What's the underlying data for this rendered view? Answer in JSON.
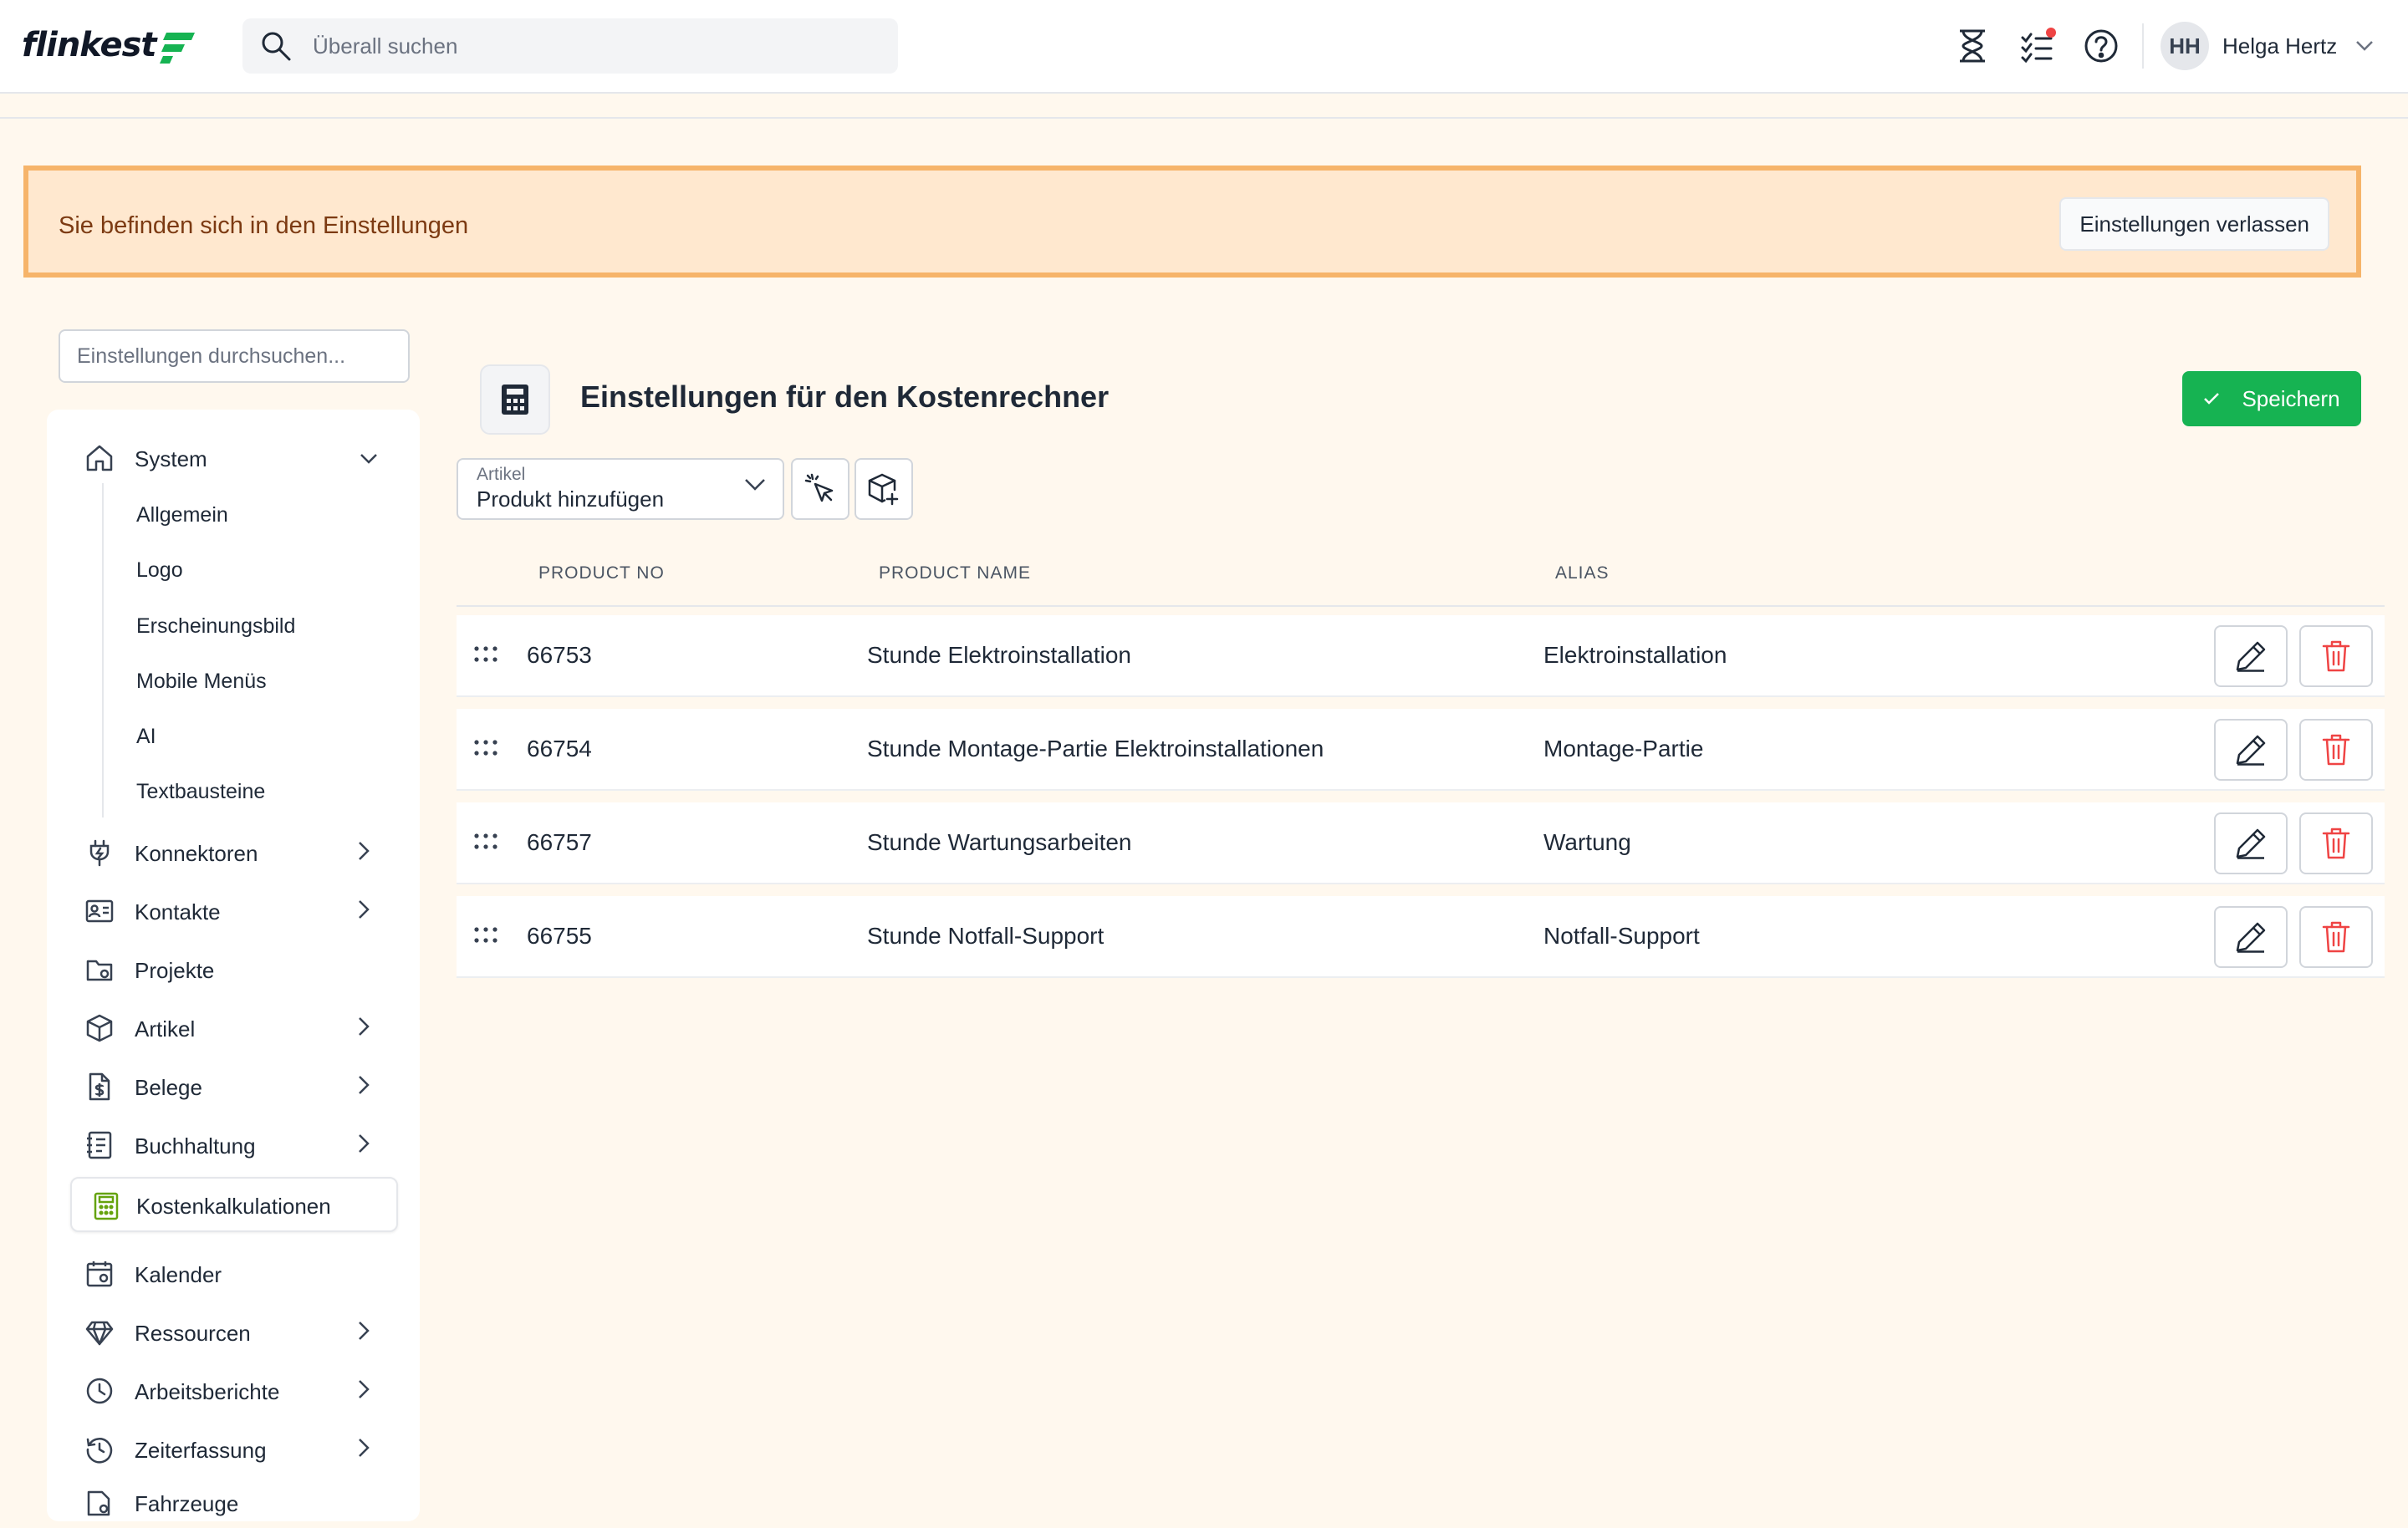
{
  "app": {
    "logo_text": "flinkest",
    "brand_color": "#16b352",
    "accent_warning": "#f6b46a"
  },
  "header": {
    "search_placeholder": "Überall suchen",
    "icons": [
      "hourglass-icon",
      "checklist-icon",
      "help-icon"
    ],
    "notification_dot_color": "#ef4444",
    "user": {
      "initials": "HH",
      "name": "Helga Hertz"
    }
  },
  "banner": {
    "message": "Sie befinden sich in den Einstellungen",
    "exit_label": "Einstellungen verlassen"
  },
  "sidebar": {
    "search_placeholder": "Einstellungen durchsuchen...",
    "system": {
      "label": "System",
      "children": [
        "Allgemein",
        "Logo",
        "Erscheinungsbild",
        "Mobile Menüs",
        "AI",
        "Textbausteine"
      ]
    },
    "items": [
      {
        "label": "Konnektoren",
        "icon": "plug-icon",
        "expandable": true
      },
      {
        "label": "Kontakte",
        "icon": "contact-card-icon",
        "expandable": true
      },
      {
        "label": "Projekte",
        "icon": "folder-gear-icon",
        "expandable": false
      },
      {
        "label": "Artikel",
        "icon": "box-icon",
        "expandable": true
      },
      {
        "label": "Belege",
        "icon": "receipt-dollar-icon",
        "expandable": true
      },
      {
        "label": "Buchhaltung",
        "icon": "ledger-icon",
        "expandable": true
      },
      {
        "label": "Kostenkalkulationen",
        "icon": "calculator-icon",
        "expandable": false,
        "active": true
      },
      {
        "label": "Kalender",
        "icon": "calendar-gear-icon",
        "expandable": false
      },
      {
        "label": "Ressourcen",
        "icon": "diamond-icon",
        "expandable": true
      },
      {
        "label": "Arbeitsberichte",
        "icon": "clock-icon",
        "expandable": true
      },
      {
        "label": "Zeiterfassung",
        "icon": "history-icon",
        "expandable": true
      },
      {
        "label": "Fahrzeuge",
        "icon": "vehicle-doc-icon",
        "expandable": false
      }
    ]
  },
  "main": {
    "title": "Einstellungen für den Kostenrechner",
    "save_label": "Speichern",
    "article_select": {
      "label": "Artikel",
      "value": "Produkt hinzufügen"
    },
    "columns": [
      "PRODUCT NO",
      "PRODUCT NAME",
      "ALIAS"
    ],
    "rows": [
      {
        "no": "66753",
        "name": "Stunde Elektroinstallation",
        "alias": "Elektroinstallation"
      },
      {
        "no": "66754",
        "name": "Stunde Montage-Partie Elektroinstallationen",
        "alias": "Montage-Partie"
      },
      {
        "no": "66757",
        "name": "Stunde Wartungsarbeiten",
        "alias": "Wartung"
      },
      {
        "no": "66755",
        "name": "Stunde Notfall-Support",
        "alias": "Notfall-Support"
      }
    ]
  }
}
